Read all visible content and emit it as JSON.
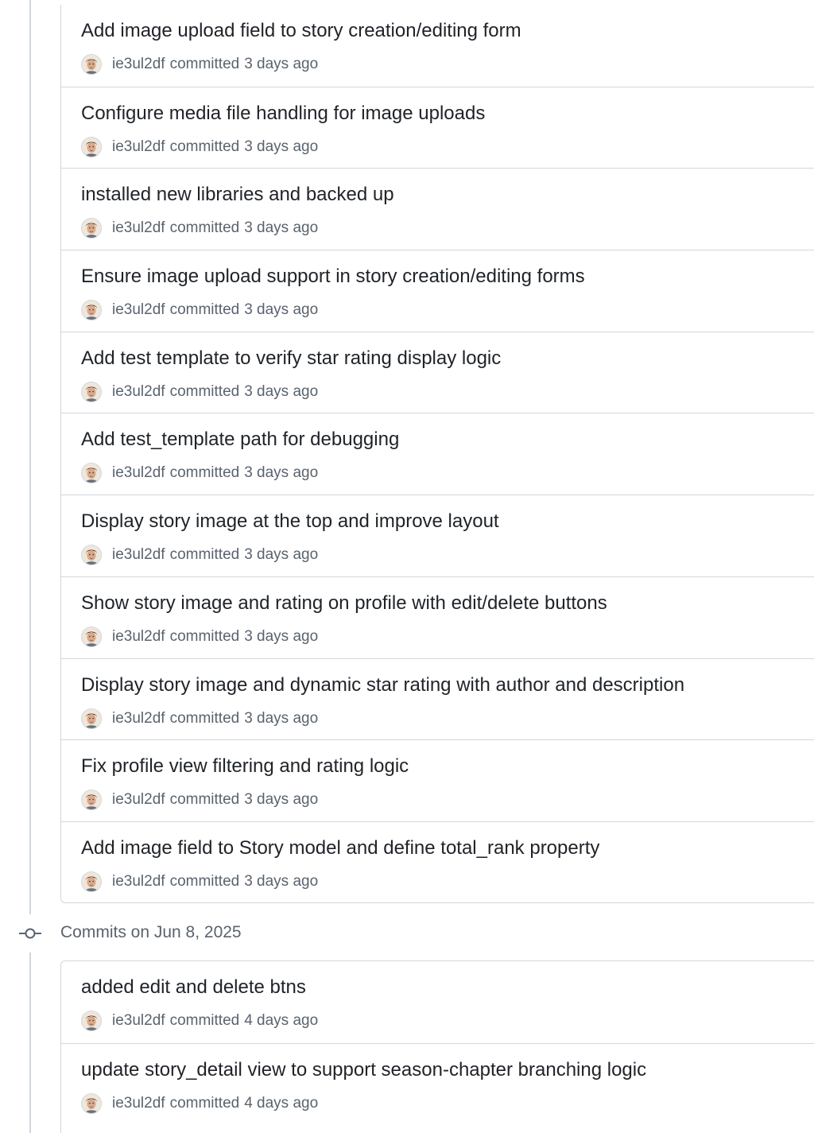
{
  "groups": [
    {
      "header": null,
      "commits": [
        {
          "title": "Add image upload field to story creation/editing form",
          "author": "ie3ul2df",
          "verb": "committed",
          "time": "3 days ago"
        },
        {
          "title": "Configure media file handling for image uploads",
          "author": "ie3ul2df",
          "verb": "committed",
          "time": "3 days ago"
        },
        {
          "title": "installed new libraries and backed up",
          "author": "ie3ul2df",
          "verb": "committed",
          "time": "3 days ago"
        },
        {
          "title": "Ensure image upload support in story creation/editing forms",
          "author": "ie3ul2df",
          "verb": "committed",
          "time": "3 days ago"
        },
        {
          "title": "Add test template to verify star rating display logic",
          "author": "ie3ul2df",
          "verb": "committed",
          "time": "3 days ago"
        },
        {
          "title": "Add test_template path for debugging",
          "author": "ie3ul2df",
          "verb": "committed",
          "time": "3 days ago"
        },
        {
          "title": "Display story image at the top and improve layout",
          "author": "ie3ul2df",
          "verb": "committed",
          "time": "3 days ago"
        },
        {
          "title": "Show story image and rating on profile with edit/delete buttons",
          "author": "ie3ul2df",
          "verb": "committed",
          "time": "3 days ago"
        },
        {
          "title": "Display story image and dynamic star rating with author and description",
          "author": "ie3ul2df",
          "verb": "committed",
          "time": "3 days ago"
        },
        {
          "title": "Fix profile view filtering and rating logic",
          "author": "ie3ul2df",
          "verb": "committed",
          "time": "3 days ago"
        },
        {
          "title": "Add image field to Story model and define total_rank property",
          "author": "ie3ul2df",
          "verb": "committed",
          "time": "3 days ago"
        }
      ]
    },
    {
      "header": "Commits on Jun 8, 2025",
      "commits": [
        {
          "title": "added edit and delete btns",
          "author": "ie3ul2df",
          "verb": "committed",
          "time": "4 days ago"
        },
        {
          "title": "update story_detail view to support season-chapter branching logic",
          "author": "ie3ul2df",
          "verb": "committed",
          "time": "4 days ago"
        }
      ]
    }
  ],
  "colors": {
    "border": "#d0d7de",
    "title": "#1f2328",
    "muted": "#59636e"
  },
  "icons": {
    "commit_node": "git-commit-icon",
    "avatar": "user-avatar"
  }
}
